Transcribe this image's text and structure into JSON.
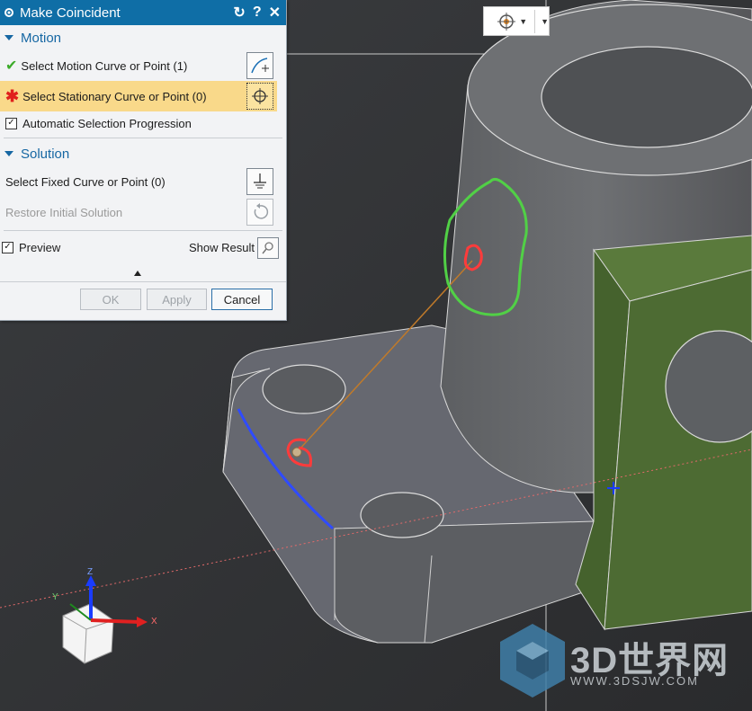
{
  "dialog": {
    "title": "Make Coincident",
    "motion": {
      "heading": "Motion",
      "select_motion": "Select Motion Curve or Point (1)",
      "select_stationary": "Select Stationary Curve or Point (0)",
      "auto_progression": "Automatic Selection Progression",
      "auto_progression_checked": true
    },
    "solution": {
      "heading": "Solution",
      "select_fixed": "Select Fixed Curve or Point (0)",
      "restore": "Restore Initial Solution"
    },
    "preview": {
      "label": "Preview",
      "checked": true,
      "show_result": "Show Result"
    },
    "buttons": {
      "ok": "OK",
      "apply": "Apply",
      "cancel": "Cancel"
    }
  },
  "view_toolbar": {
    "icon": "snap-point-icon"
  },
  "axes": {
    "z": "Z",
    "y": "Y",
    "x": "X"
  },
  "watermark": {
    "logo": "3D世界网",
    "url": "WWW.3DSJW.COM"
  },
  "colors": {
    "title_bar": "#0f6ea6",
    "highlight_row": "#f9d98a",
    "model_gray": "#6a6c6f",
    "green_face": "#4d6b33",
    "annotation_green": "#51d046",
    "annotation_red": "#ff3b3b",
    "selected_edge": "#2f4bff"
  }
}
